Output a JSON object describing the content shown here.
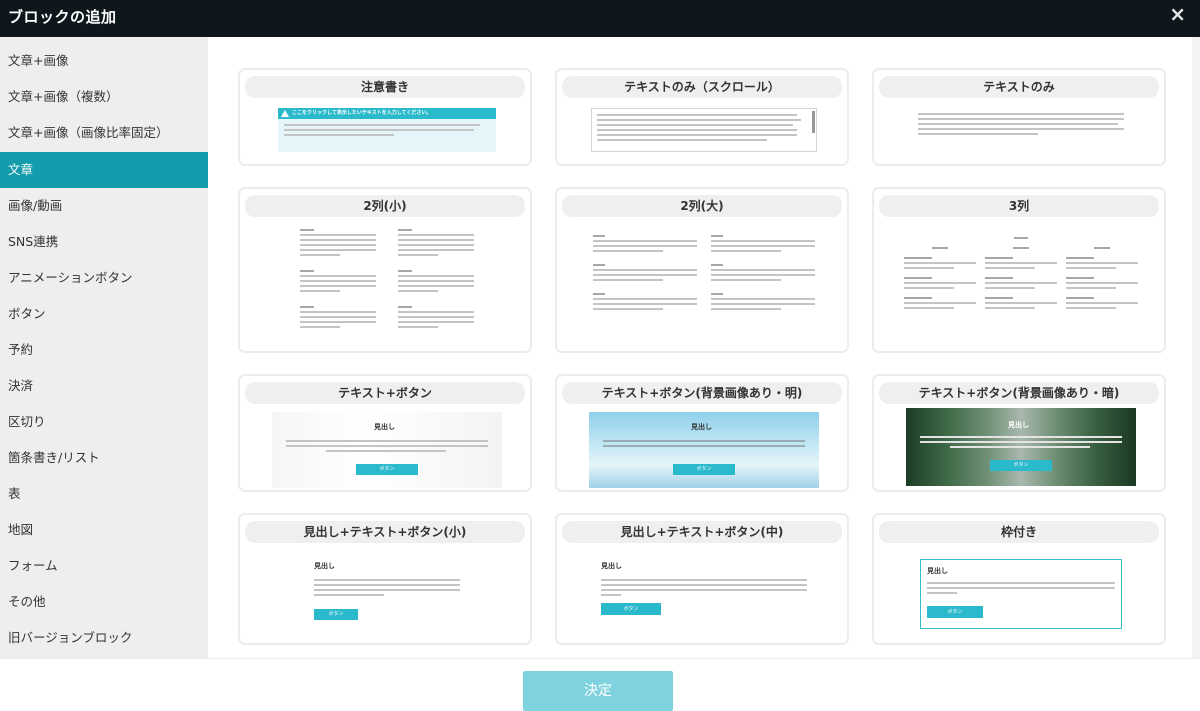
{
  "dialog": {
    "title": "ブロックの追加",
    "close_label": "×",
    "ok_label": "決定"
  },
  "sidebar": {
    "items": [
      {
        "label": "文章+画像"
      },
      {
        "label": "文章+画像（複数）"
      },
      {
        "label": "文章+画像（画像比率固定）"
      },
      {
        "label": "文章",
        "active": true
      },
      {
        "label": "画像/動画"
      },
      {
        "label": "SNS連携"
      },
      {
        "label": "アニメーションボタン"
      },
      {
        "label": "ボタン"
      },
      {
        "label": "予約"
      },
      {
        "label": "決済"
      },
      {
        "label": "区切り"
      },
      {
        "label": "箇条書き/リスト"
      },
      {
        "label": "表"
      },
      {
        "label": "地図"
      },
      {
        "label": "フォーム"
      },
      {
        "label": "その他"
      },
      {
        "label": "旧バージョンブロック"
      }
    ]
  },
  "preview_text": {
    "notice_header": "ここをクリックして表示したいテキストを入力してください。",
    "heading": "見出し",
    "button": "ボタン"
  },
  "cards": [
    {
      "title": "注意書き"
    },
    {
      "title": "テキストのみ（スクロール）"
    },
    {
      "title": "テキストのみ"
    },
    {
      "title": "2列(小)"
    },
    {
      "title": "2列(大)"
    },
    {
      "title": "3列"
    },
    {
      "title": "テキスト+ボタン"
    },
    {
      "title": "テキスト+ボタン(背景画像あり・明)"
    },
    {
      "title": "テキスト+ボタン(背景画像あり・暗)"
    },
    {
      "title": "見出し+テキスト+ボタン(小)"
    },
    {
      "title": "見出し+テキスト+ボタン(中)"
    },
    {
      "title": "枠付き"
    }
  ],
  "colors": {
    "accent": "#139cab",
    "button": "#2bb9cc",
    "titlebar": "#0d171c"
  }
}
